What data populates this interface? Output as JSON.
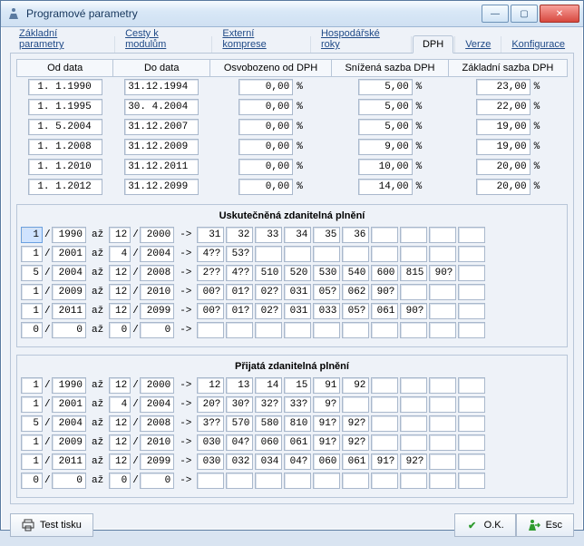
{
  "window": {
    "title": "Programové parametry"
  },
  "tabs": {
    "t0": "Základní parametry",
    "t1": "Cesty k modulům",
    "t2": "Externí komprese",
    "t3": "Hospodářské roky",
    "t4": "DPH",
    "t5": "Verze",
    "t6": "Konfigurace"
  },
  "vat_headers": {
    "from": "Od data",
    "to": "Do data",
    "free": "Osvobozeno od DPH",
    "low": "Snížená sazba DPH",
    "base": "Základní sazba DPH"
  },
  "vat_rows": [
    {
      "from": " 1. 1.1990",
      "to": "31.12.1994",
      "free": "0,00",
      "low": "5,00",
      "base": "23,00"
    },
    {
      "from": " 1. 1.1995",
      "to": "30. 4.2004",
      "free": "0,00",
      "low": "5,00",
      "base": "22,00"
    },
    {
      "from": " 1. 5.2004",
      "to": "31.12.2007",
      "free": "0,00",
      "low": "5,00",
      "base": "19,00"
    },
    {
      "from": " 1. 1.2008",
      "to": "31.12.2009",
      "free": "0,00",
      "low": "9,00",
      "base": "19,00"
    },
    {
      "from": " 1. 1.2010",
      "to": "31.12.2011",
      "free": "0,00",
      "low": "10,00",
      "base": "20,00"
    },
    {
      "from": " 1. 1.2012",
      "to": "31.12.2099",
      "free": "0,00",
      "low": "14,00",
      "base": "20,00"
    }
  ],
  "groups": {
    "usk": "Uskutečněná zdanitelná plnění",
    "pri": "Přijatá zdanitelná plnění"
  },
  "tokens": {
    "az": "až",
    "arrow": "->",
    "slash": "/",
    "pct": "%"
  },
  "usk_rows": [
    {
      "m1": "1",
      "y1": "1990",
      "m2": "12",
      "y2": "2000",
      "codes": [
        "31",
        "32",
        "33",
        "34",
        "35",
        "36",
        "",
        "",
        "",
        ""
      ],
      "sel": true
    },
    {
      "m1": "1",
      "y1": "2001",
      "m2": "4",
      "y2": "2004",
      "codes": [
        "4??",
        "53?",
        "",
        "",
        "",
        "",
        "",
        "",
        "",
        ""
      ]
    },
    {
      "m1": "5",
      "y1": "2004",
      "m2": "12",
      "y2": "2008",
      "codes": [
        "2??",
        "4??",
        "510",
        "520",
        "530",
        "540",
        "600",
        "815",
        "90?",
        ""
      ]
    },
    {
      "m1": "1",
      "y1": "2009",
      "m2": "12",
      "y2": "2010",
      "codes": [
        "00?",
        "01?",
        "02?",
        "031",
        "05?",
        "062",
        "90?",
        "",
        "",
        ""
      ]
    },
    {
      "m1": "1",
      "y1": "2011",
      "m2": "12",
      "y2": "2099",
      "codes": [
        "00?",
        "01?",
        "02?",
        "031",
        "033",
        "05?",
        "061",
        "90?",
        "",
        ""
      ]
    },
    {
      "m1": "0",
      "y1": "0",
      "m2": "0",
      "y2": "0",
      "codes": [
        "",
        "",
        "",
        "",
        "",
        "",
        "",
        "",
        "",
        ""
      ]
    }
  ],
  "pri_rows": [
    {
      "m1": "1",
      "y1": "1990",
      "m2": "12",
      "y2": "2000",
      "codes": [
        "12",
        "13",
        "14",
        "15",
        "91",
        "92",
        "",
        "",
        "",
        ""
      ]
    },
    {
      "m1": "1",
      "y1": "2001",
      "m2": "4",
      "y2": "2004",
      "codes": [
        "20?",
        "30?",
        "32?",
        "33?",
        "9?",
        "",
        "",
        "",
        "",
        ""
      ]
    },
    {
      "m1": "5",
      "y1": "2004",
      "m2": "12",
      "y2": "2008",
      "codes": [
        "3??",
        "570",
        "580",
        "810",
        "91?",
        "92?",
        "",
        "",
        "",
        ""
      ]
    },
    {
      "m1": "1",
      "y1": "2009",
      "m2": "12",
      "y2": "2010",
      "codes": [
        "030",
        "04?",
        "060",
        "061",
        "91?",
        "92?",
        "",
        "",
        "",
        ""
      ]
    },
    {
      "m1": "1",
      "y1": "2011",
      "m2": "12",
      "y2": "2099",
      "codes": [
        "030",
        "032",
        "034",
        "04?",
        "060",
        "061",
        "91?",
        "92?",
        "",
        ""
      ]
    },
    {
      "m1": "0",
      "y1": "0",
      "m2": "0",
      "y2": "0",
      "codes": [
        "",
        "",
        "",
        "",
        "",
        "",
        "",
        "",
        "",
        ""
      ]
    }
  ],
  "footer": {
    "test": "Test tisku",
    "ok": "O.K.",
    "esc": "Esc"
  }
}
